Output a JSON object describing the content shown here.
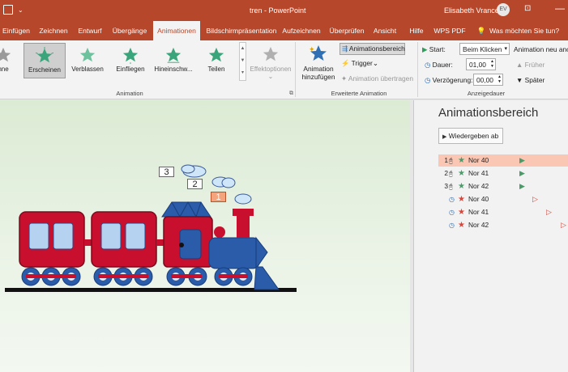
{
  "window": {
    "qat_icon": "save-icon",
    "doc_title": "tren  -  PowerPoint",
    "user_name": "Elisabeth Vrancea",
    "user_initials": "EV"
  },
  "tabs": [
    "Einfügen",
    "Zeichnen",
    "Entwurf",
    "Übergänge",
    "Animationen",
    "Bildschirmpräsentation",
    "Aufzeichnen",
    "Überprüfen",
    "Ansicht",
    "Hilfe",
    "WPS PDF"
  ],
  "active_tab": "Animationen",
  "tell_me": "Was möchten Sie tun?",
  "ribbon": {
    "animations": [
      {
        "label": "nne",
        "icon": "star-gray-icon"
      },
      {
        "label": "Erscheinen",
        "icon": "star-appear-icon"
      },
      {
        "label": "Verblassen",
        "icon": "star-fade-icon"
      },
      {
        "label": "Einfliegen",
        "icon": "star-flyin-icon"
      },
      {
        "label": "Hineinschw...",
        "icon": "star-swivel-icon"
      },
      {
        "label": "Teilen",
        "icon": "star-split-icon"
      }
    ],
    "effect_options": "Effektoptionen",
    "group_animation": "Animation",
    "add_animation_line1": "Animation",
    "add_animation_line2": "hinzufügen",
    "animation_pane_btn": "Animationsbereich",
    "trigger": "Trigger",
    "animation_painter": "Animation übertragen",
    "group_advanced": "Erweiterte Animation",
    "start_label": "Start:",
    "start_value": "Beim Klicken",
    "duration_label": "Dauer:",
    "duration_value": "01,00",
    "delay_label": "Verzögerung:",
    "delay_value": "00,00",
    "reorder_title": "Animation neu anor",
    "earlier": "Früher",
    "later": "Später",
    "group_timing": "Anzeigedauer"
  },
  "slide": {
    "markers": [
      "3",
      "2",
      "1"
    ]
  },
  "pane": {
    "title": "Animationsbereich",
    "play_button": "Wiedergeben ab",
    "items": [
      {
        "num": "1",
        "trigger": "click",
        "name": "Nor 40",
        "type": "entrance",
        "color": "#4a9a6a",
        "selected": true
      },
      {
        "num": "2",
        "trigger": "click",
        "name": "Nor 41",
        "type": "entrance",
        "color": "#4a9a6a",
        "selected": false
      },
      {
        "num": "3",
        "trigger": "click",
        "name": "Nor 42",
        "type": "entrance",
        "color": "#4a9a6a",
        "selected": false
      },
      {
        "num": "",
        "trigger": "clock",
        "name": "Nor 40",
        "type": "exit",
        "color": "#d9453a",
        "selected": false
      },
      {
        "num": "",
        "trigger": "clock",
        "name": "Nor 41",
        "type": "exit",
        "color": "#d9453a",
        "selected": false
      },
      {
        "num": "",
        "trigger": "clock",
        "name": "Nor 42",
        "type": "exit",
        "color": "#d9453a",
        "selected": false
      }
    ]
  }
}
